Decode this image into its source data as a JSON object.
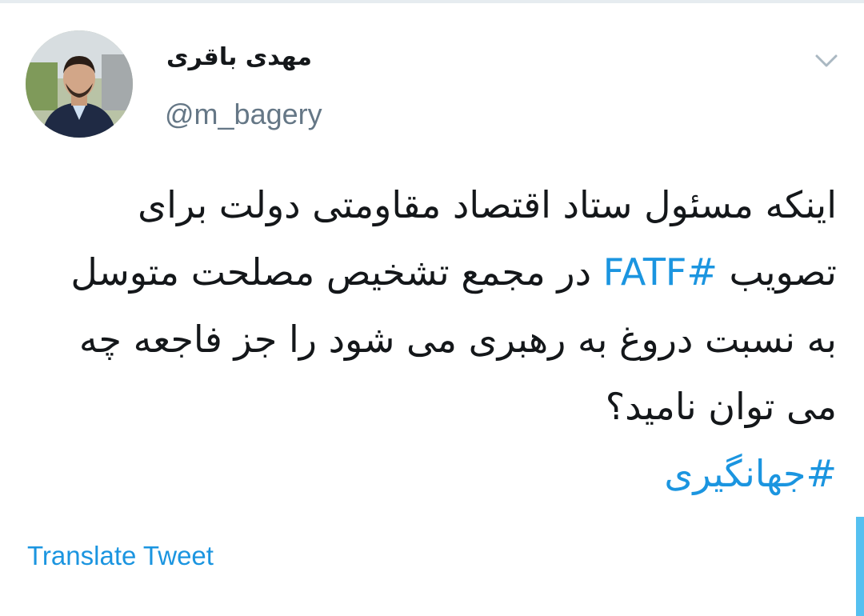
{
  "author": {
    "display_name": "مهدی باقری",
    "handle": "@m_bagery"
  },
  "tweet": {
    "text_before": "اینکه مسئول ستاد اقتصاد مقاومتی دولت برای تصویب ",
    "hashtag_fatf": "#FATF",
    "text_after": " در مجمع تشخیص مصلحت متوسل به نسبت دروغ به رهبری می شود را جز فاجعه چه می توان نامید؟",
    "hashtag_end": "#جهانگیری"
  },
  "actions": {
    "translate_label": "Translate Tweet"
  },
  "icons": {
    "menu_caret": "chevron-down-icon",
    "avatar": "avatar"
  },
  "colors": {
    "link": "#1b95e0",
    "handle": "#657786",
    "text": "#14171a"
  }
}
